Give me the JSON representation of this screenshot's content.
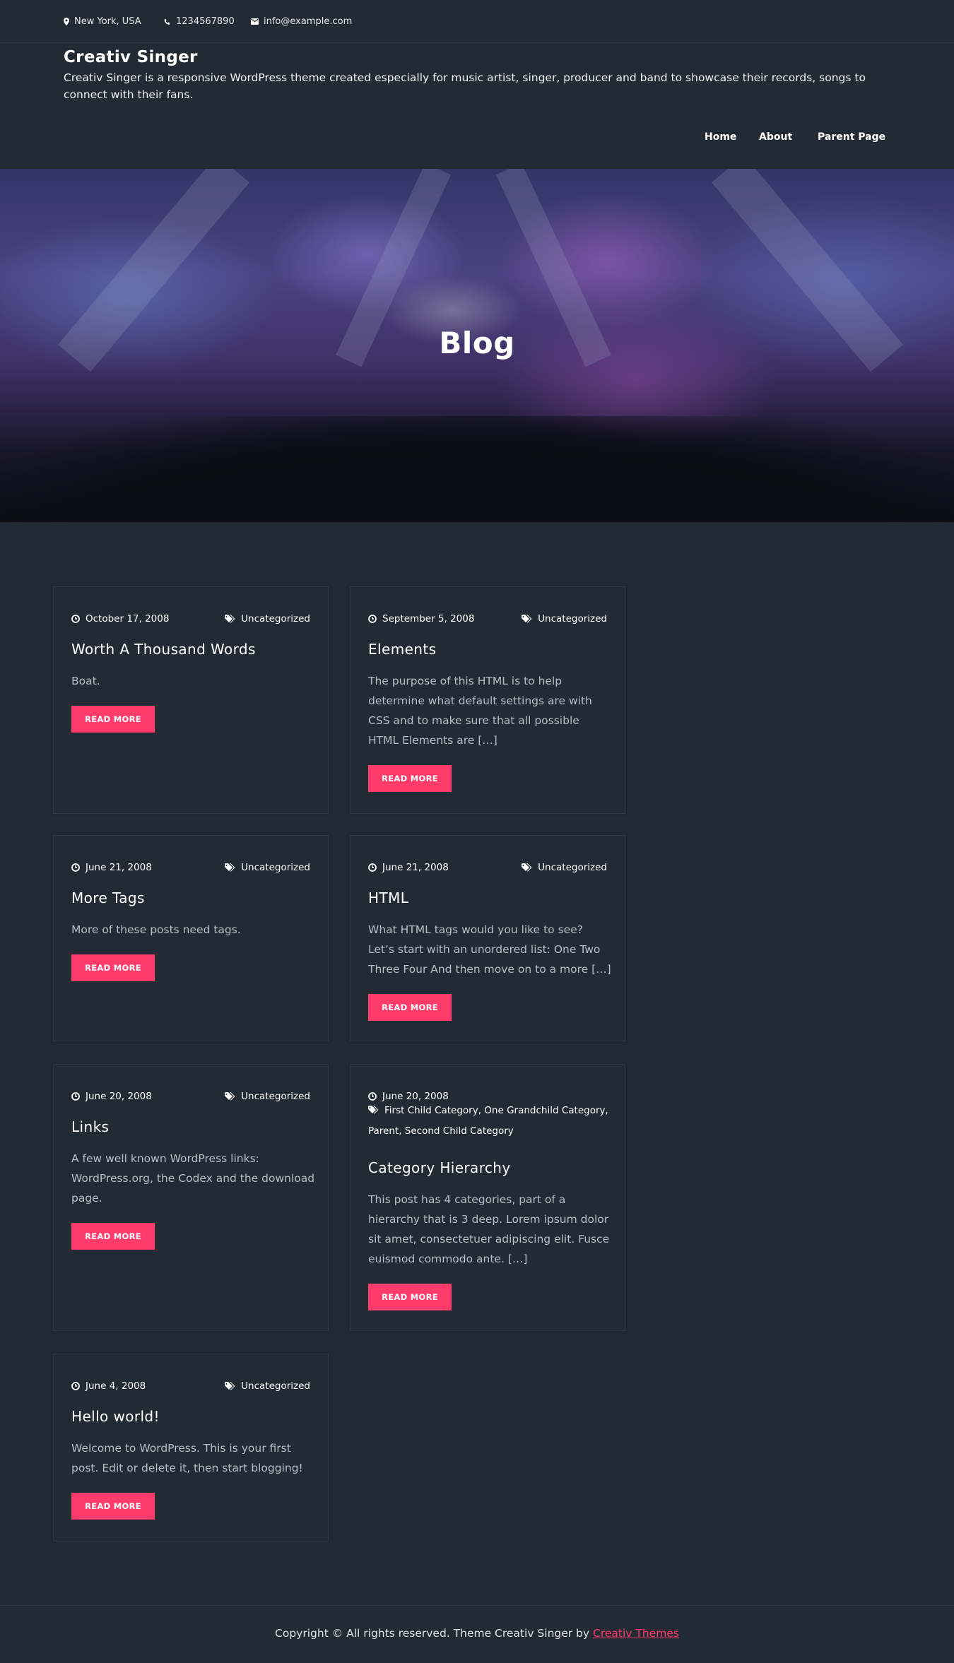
{
  "topbar": {
    "location": "New York, USA",
    "phone": "1234567890",
    "email": "info@example.com"
  },
  "header": {
    "site_title": "Creativ Singer",
    "site_description": "Creativ Singer is a responsive WordPress theme created especially for music artist, singer, producer and band to showcase their records, songs to connect with their fans.",
    "nav": [
      "Home",
      "About",
      "Parent Page"
    ]
  },
  "hero": {
    "title": "Blog"
  },
  "posts": [
    {
      "date": "October 17, 2008",
      "category": "Uncategorized",
      "title": "Worth A Thousand Words",
      "excerpt": "Boat.",
      "button": "READ MORE"
    },
    {
      "date": "September 5, 2008",
      "category": "Uncategorized",
      "title": "Elements",
      "excerpt": "The purpose of this HTML is to help determine what default settings are with CSS and to make sure that all possible HTML Elements are […]",
      "button": "READ MORE"
    },
    {
      "date": "June 21, 2008",
      "category": "Uncategorized",
      "title": "More Tags",
      "excerpt": "More of these posts need tags.",
      "button": "READ MORE"
    },
    {
      "date": "June 21, 2008",
      "category": "Uncategorized",
      "title": "HTML",
      "excerpt": "What HTML tags would you like to see? Let’s start with an unordered list: One Two Three Four And then move on to a more […]",
      "button": "READ MORE"
    },
    {
      "date": "June 20, 2008",
      "category": "Uncategorized",
      "title": "Links",
      "excerpt": "A few well known WordPress links: WordPress.org, the Codex and the download page.",
      "button": "READ MORE"
    },
    {
      "date": "June 20, 2008",
      "category": "First Child Category, One Grandchild Category, Parent, Second Child Category",
      "title": "Category Hierarchy",
      "excerpt": "This post has 4 categories, part of a hierarchy that is 3 deep. Lorem ipsum dolor sit amet, consectetuer adipiscing elit. Fusce euismod commodo ante. […]",
      "button": "READ MORE"
    },
    {
      "date": "June 4, 2008",
      "category": "Uncategorized",
      "title": "Hello world!",
      "excerpt": "Welcome to WordPress. This is your first post. Edit or delete it, then start blogging!",
      "button": "READ MORE"
    }
  ],
  "footer": {
    "copyright": "Copyright © All rights reserved. Theme Creativ Singer by ",
    "credit_link": "Creativ Themes"
  },
  "colors": {
    "background": "#212a33",
    "accent": "#ff3b6b"
  }
}
